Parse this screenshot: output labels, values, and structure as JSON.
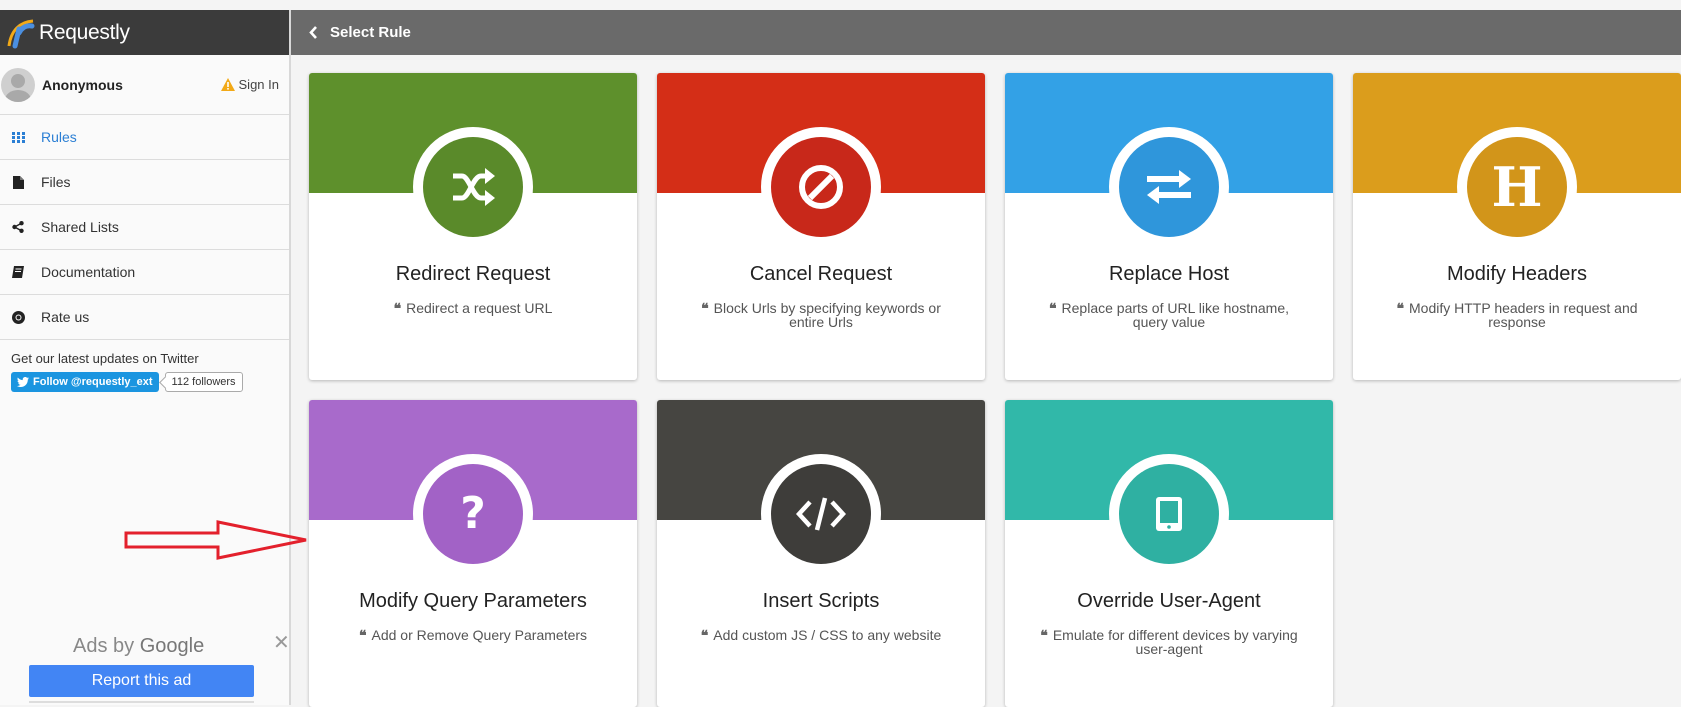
{
  "app": {
    "name": "Requestly"
  },
  "user": {
    "name": "Anonymous",
    "signin_label": "Sign In"
  },
  "nav": [
    {
      "label": "Rules",
      "icon": "grid-icon",
      "active": true
    },
    {
      "label": "Files",
      "icon": "file-icon"
    },
    {
      "label": "Shared Lists",
      "icon": "share-icon"
    },
    {
      "label": "Documentation",
      "icon": "book-icon"
    },
    {
      "label": "Rate us",
      "icon": "chrome-icon"
    }
  ],
  "twitter": {
    "note": "Get our latest updates on Twitter",
    "follow_label": "Follow @requestly_ext",
    "followers": "112 followers"
  },
  "ads": {
    "prefix": "Ads by",
    "brand": "Google",
    "report_label": "Report this ad",
    "close": "✕"
  },
  "header": {
    "title": "Select Rule"
  },
  "rules": [
    {
      "title": "Redirect Request",
      "desc": "Redirect a request URL",
      "color": "#5e902c",
      "disc": "#5a8a2a",
      "icon": "shuffle-icon"
    },
    {
      "title": "Cancel Request",
      "desc": "Block Urls by specifying keywords or entire Urls",
      "color": "#d42e17",
      "disc": "#c8281a",
      "icon": "ban-icon"
    },
    {
      "title": "Replace Host",
      "desc": "Replace parts of URL like hostname, query value",
      "color": "#33a1e6",
      "disc": "#2f96db",
      "icon": "swap-icon"
    },
    {
      "title": "Modify Headers",
      "desc": "Modify HTTP headers in request and response",
      "color": "#db9d1c",
      "disc": "#d2951a",
      "icon": "header-icon"
    },
    {
      "title": "Modify Query Parameters",
      "desc": "Add or Remove Query Parameters",
      "color": "#a86acb",
      "disc": "#a262c6",
      "icon": "question-icon"
    },
    {
      "title": "Insert Scripts",
      "desc": "Add custom JS / CSS to any website",
      "color": "#464541",
      "disc": "#3e3d3a",
      "icon": "code-icon"
    },
    {
      "title": "Override User-Agent",
      "desc": "Emulate for different devices by varying user-agent",
      "color": "#31b8a9",
      "disc": "#2fb0a2",
      "icon": "tablet-icon"
    }
  ]
}
